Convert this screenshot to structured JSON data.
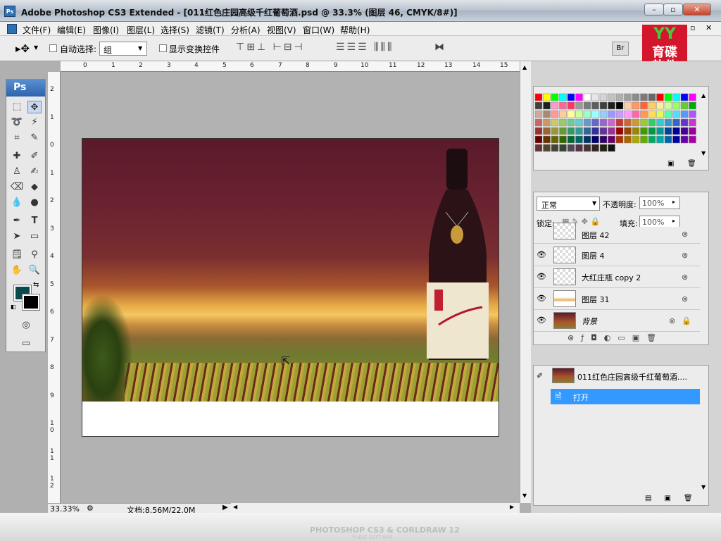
{
  "window": {
    "title": "Adobe Photoshop CS3 Extended - [011红色庄园高级千红葡萄酒.psd @ 33.3% (图层 46, CMYK/8#)]",
    "app_icon": "Ps",
    "minimize": "–",
    "restore": "▫",
    "close": "✕"
  },
  "menu": {
    "items": [
      "文件(F)",
      "编辑(E)",
      "图像(I)",
      "图层(L)",
      "选择(S)",
      "滤镜(T)",
      "分析(A)",
      "视图(V)",
      "窗口(W)",
      "帮助(H)"
    ]
  },
  "options": {
    "auto_select_label": "自动选择:",
    "auto_select_value": "组",
    "show_transform_label": "显示变换控件"
  },
  "toolbox": {
    "header": "Ps"
  },
  "ruler": {
    "top": [
      "0",
      "1",
      "2",
      "3",
      "4",
      "5",
      "6",
      "7",
      "8",
      "9",
      "10",
      "11",
      "12",
      "13",
      "14",
      "15"
    ],
    "left": [
      "2",
      "1",
      "0",
      "1",
      "2",
      "3",
      "4",
      "5",
      "6",
      "7",
      "8",
      "9",
      "1\n0",
      "1\n1",
      "1\n2",
      "1\n3"
    ]
  },
  "status": {
    "zoom": "33.33%",
    "doc_info": "文档:8.56M/22.0M"
  },
  "logo": {
    "text": "育碟\n软件",
    "top": "YY"
  },
  "layers": {
    "blend_mode": "正常",
    "opacity_label": "不透明度:",
    "opacity_value": "100%",
    "lock_label": "锁定:",
    "fill_label": "填充:",
    "fill_value": "100%",
    "items": [
      {
        "name": "图层 42"
      },
      {
        "name": "图层 4"
      },
      {
        "name": "大红庄瓶 copy 2"
      },
      {
        "name": "图层 31"
      },
      {
        "name": "背景"
      }
    ]
  },
  "history": {
    "snapshot": "011红色庄园高级千红葡萄酒....",
    "open": "打开"
  },
  "watermark": {
    "main": "PHOTOSHOP CS3 & CORLDRAW 12",
    "sub": "YUDIE SOFTWAR"
  },
  "colors": {
    "accent": "#3399ff",
    "fg": "#0a4a4a",
    "bg": "#000000",
    "swatch_rows": [
      [
        "#ff0000",
        "#ffff00",
        "#00ff00",
        "#00ffff",
        "#0000ff",
        "#ff00ff",
        "#ffffff",
        "#e6e6e6",
        "#d4d4d4",
        "#c2c2c2",
        "#b0b0b0",
        "#9e9e9e",
        "#8c8c8c",
        "#7a7a7a",
        "#686868",
        "#ff0000",
        "#00ff00",
        "#00ffff",
        "#0000ff",
        "#ff00ff"
      ],
      [
        "#404040",
        "#1e1e1e",
        "#ff99cc",
        "#ff6699",
        "#ff3366",
        "#9a9a9a",
        "#7c7c7c",
        "#5e5e5e",
        "#404040",
        "#1e1e1e",
        "#000000",
        "#ffccaa",
        "#ff9966",
        "#ff6633",
        "#ffcc66",
        "#ffee99",
        "#ccff99",
        "#99ff66",
        "#66cc33",
        "#00aa00"
      ],
      [
        "#ccaa99",
        "#aa8877",
        "#ff9999",
        "#ffcc99",
        "#ffff99",
        "#ccff99",
        "#99ffcc",
        "#99ffff",
        "#99ccff",
        "#9999ff",
        "#cc99ff",
        "#ff99ff",
        "#ff66aa",
        "#ff9955",
        "#ffdd55",
        "#ddff55",
        "#55ffaa",
        "#55ddff",
        "#5599ff",
        "#aa55ff"
      ],
      [
        "#cc6666",
        "#cc9966",
        "#cccc66",
        "#99cc66",
        "#66cc99",
        "#66cccc",
        "#6699cc",
        "#6666cc",
        "#9966cc",
        "#cc66cc",
        "#cc3333",
        "#cc6633",
        "#cc9933",
        "#99cc33",
        "#33cc66",
        "#33cccc",
        "#3399cc",
        "#3366cc",
        "#6633cc",
        "#cc33cc"
      ],
      [
        "#993333",
        "#996633",
        "#999933",
        "#669933",
        "#339966",
        "#339999",
        "#336699",
        "#333399",
        "#663399",
        "#993399",
        "#990000",
        "#994400",
        "#998800",
        "#449900",
        "#009944",
        "#009999",
        "#004499",
        "#000099",
        "#440099",
        "#990099"
      ],
      [
        "#660000",
        "#663300",
        "#666600",
        "#336600",
        "#006633",
        "#006666",
        "#003366",
        "#000066",
        "#330066",
        "#660066",
        "#aa3300",
        "#aa6600",
        "#aaaa00",
        "#66aa00",
        "#00aa66",
        "#00aaaa",
        "#0066aa",
        "#0000aa",
        "#6600aa",
        "#aa00aa"
      ],
      [
        "#663333",
        "#554433",
        "#444433",
        "#334433",
        "#554455",
        "#553344",
        "#443333",
        "#332222",
        "#222211",
        "#111111",
        "",
        "",
        "",
        "",
        "",
        "",
        "",
        "",
        "",
        ""
      ]
    ]
  }
}
